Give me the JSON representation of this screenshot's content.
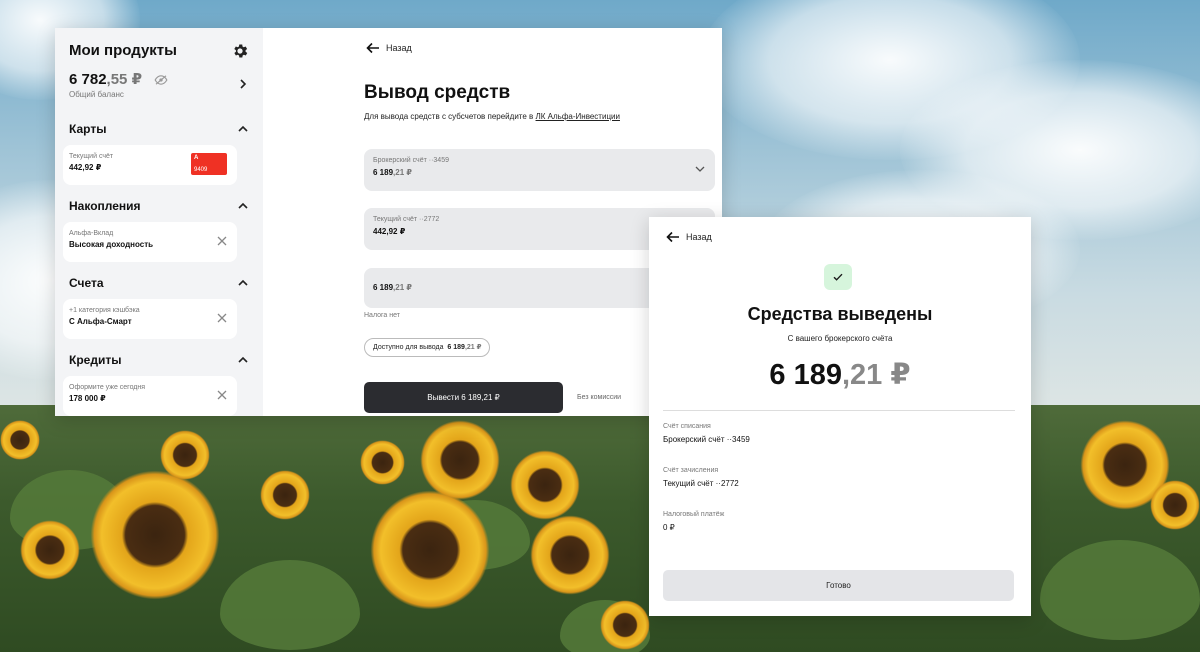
{
  "colors": {
    "accent_red": "#ef3124",
    "button_dark": "#2b2c30",
    "field_bg": "#e9eaec",
    "success_bg": "#d6f5dc",
    "sidebar_bg": "#f3f4f6"
  },
  "sidebar": {
    "title": "Мои продукты",
    "settings_icon": "gear-icon",
    "balance": {
      "main": "6 782",
      "kop": ",55 ₽",
      "label": "Общий баланс",
      "hide_icon": "eye-off-icon"
    },
    "sections": [
      {
        "title": "Карты",
        "item": {
          "line1": "Текущий счёт",
          "line2": "442,92 ₽",
          "card_label": "9409",
          "card_logo": "A"
        }
      },
      {
        "title": "Накопления",
        "item": {
          "line1": "Альфа-Вклад",
          "line2": "Высокая доходность"
        }
      },
      {
        "title": "Счета",
        "item": {
          "line1": "+1 категория кэшбэка",
          "line2": "С Альфа-Смарт"
        }
      },
      {
        "title": "Кредиты",
        "item": {
          "line1": "Оформите уже сегодня",
          "line2": "178 000 ₽"
        }
      }
    ]
  },
  "withdraw": {
    "back_label": "Назад",
    "title": "Вывод средств",
    "hint_prefix": "Для вывода средств с субсчетов перейдите в",
    "hint_link": "ЛК Альфа-Инвестиции",
    "from_account": {
      "label": "Брокерский счёт ··3459",
      "amount_main": "6 189",
      "amount_kop": ",21 ₽"
    },
    "to_account": {
      "label": "Текущий счёт ··2772",
      "amount": "442,92 ₽"
    },
    "amount_input": {
      "main": "6 189",
      "kop": ",21 ₽"
    },
    "tax_note": "Налога нет",
    "available": {
      "label": "Доступно для вывода",
      "main": "6 189",
      "kop": ",21 ₽"
    },
    "button_label": "Вывести  6 189,21 ₽",
    "fee_note": "Без комиссии"
  },
  "result": {
    "back_label": "Назад",
    "status_icon": "check-icon",
    "title": "Средства выведены",
    "subtitle": "С вашего брокерского счёта",
    "amount_main": "6 189",
    "amount_kop": ",21 ₽",
    "details": [
      {
        "key": "Счёт списания",
        "value": "Брокерский счёт ··3459"
      },
      {
        "key": "Счёт зачисления",
        "value": "Текущий счёт ··2772"
      },
      {
        "key": "Налоговый платёж",
        "value": "0 ₽"
      }
    ],
    "done_label": "Готово"
  }
}
